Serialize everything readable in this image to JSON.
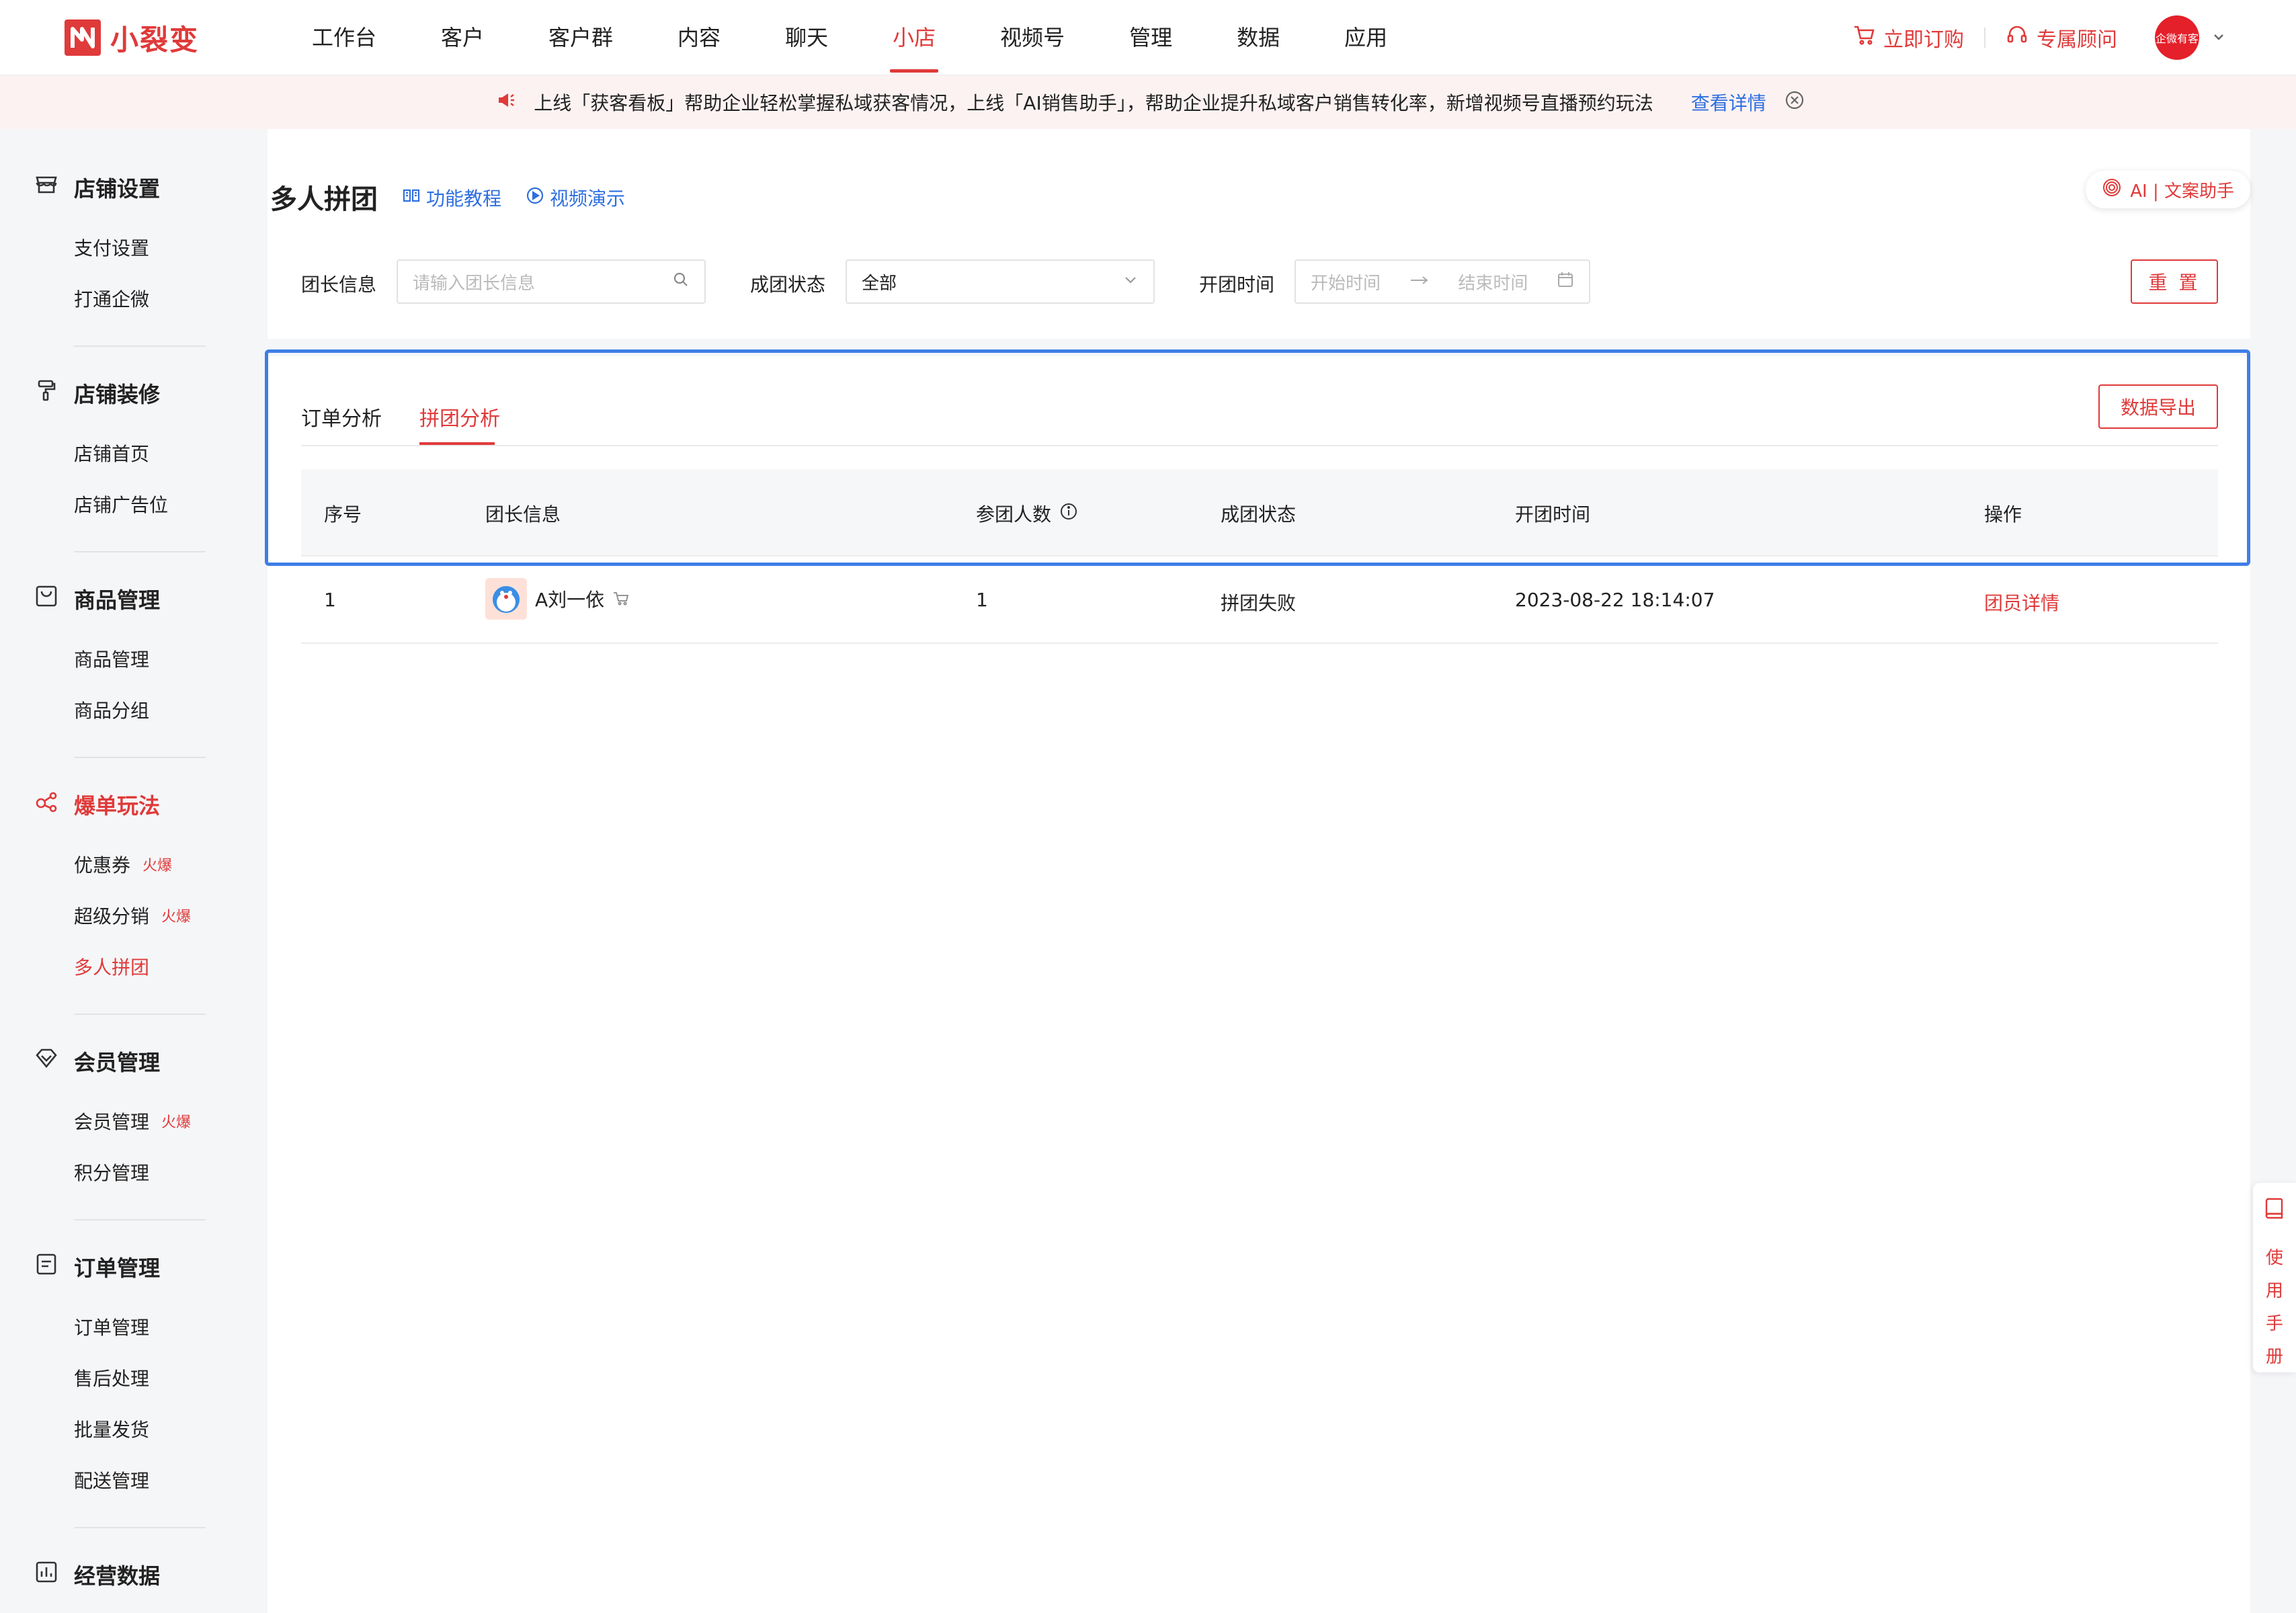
{
  "app": {
    "name": "小裂变"
  },
  "nav": {
    "items": [
      "工作台",
      "客户",
      "客户群",
      "内容",
      "聊天",
      "小店",
      "视频号",
      "管理",
      "数据",
      "应用"
    ],
    "active_index": 5
  },
  "header_right": {
    "order_label": "立即订购",
    "consultant_label": "专属顾问",
    "avatar_text": "企微有客"
  },
  "announcement": {
    "text": "上线「获客看板」帮助企业轻松掌握私域获客情况，上线「AI销售助手」，帮助企业提升私域客户销售转化率，新增视频号直播预约玩法",
    "link_label": "查看详情"
  },
  "sidebar": {
    "groups": [
      {
        "title": "店铺设置",
        "icon": "store-icon",
        "items": [
          {
            "label": "支付设置"
          },
          {
            "label": "打通企微"
          }
        ]
      },
      {
        "title": "店铺装修",
        "icon": "paint-roller-icon",
        "items": [
          {
            "label": "店铺首页"
          },
          {
            "label": "店铺广告位"
          }
        ]
      },
      {
        "title": "商品管理",
        "icon": "shopping-bag-icon",
        "items": [
          {
            "label": "商品管理"
          },
          {
            "label": "商品分组"
          }
        ]
      },
      {
        "title": "爆单玩法",
        "icon": "share-nodes-icon",
        "items": [
          {
            "label": "优惠券",
            "badge": "火爆"
          },
          {
            "label": "超级分销",
            "badge": "火爆"
          },
          {
            "label": "多人拼团"
          }
        ]
      },
      {
        "title": "会员管理",
        "icon": "diamond-icon",
        "items": [
          {
            "label": "会员管理",
            "badge": "火爆"
          },
          {
            "label": "积分管理"
          }
        ]
      },
      {
        "title": "订单管理",
        "icon": "order-list-icon",
        "items": [
          {
            "label": "订单管理"
          },
          {
            "label": "售后处理"
          },
          {
            "label": "批量发货"
          },
          {
            "label": "配送管理"
          }
        ]
      },
      {
        "title": "经营数据",
        "icon": "bar-chart-icon",
        "items": []
      }
    ]
  },
  "page": {
    "title": "多人拼团",
    "tutorial_label": "功能教程",
    "video_label": "视频演示",
    "ai_label": "AI | 文案助手"
  },
  "filters": {
    "leader_label": "团长信息",
    "leader_placeholder": "请输入团长信息",
    "status_label": "成团状态",
    "status_value": "全部",
    "time_label": "开团时间",
    "start_placeholder": "开始时间",
    "end_placeholder": "结束时间",
    "reset_label": "重 置"
  },
  "tabs": {
    "items": [
      "订单分析",
      "拼团分析"
    ],
    "active_index": 1
  },
  "export_label": "数据导出",
  "table": {
    "columns": [
      "序号",
      "团长信息",
      "参团人数",
      "成团状态",
      "开团时间",
      "操作"
    ],
    "rows": [
      {
        "index": "1",
        "leader": "A刘一依",
        "participants": "1",
        "status": "拼团失败",
        "time": "2023-08-22 18:14:07",
        "action": "团员详情"
      }
    ]
  },
  "manual_label": [
    "使",
    "用",
    "手",
    "册"
  ]
}
